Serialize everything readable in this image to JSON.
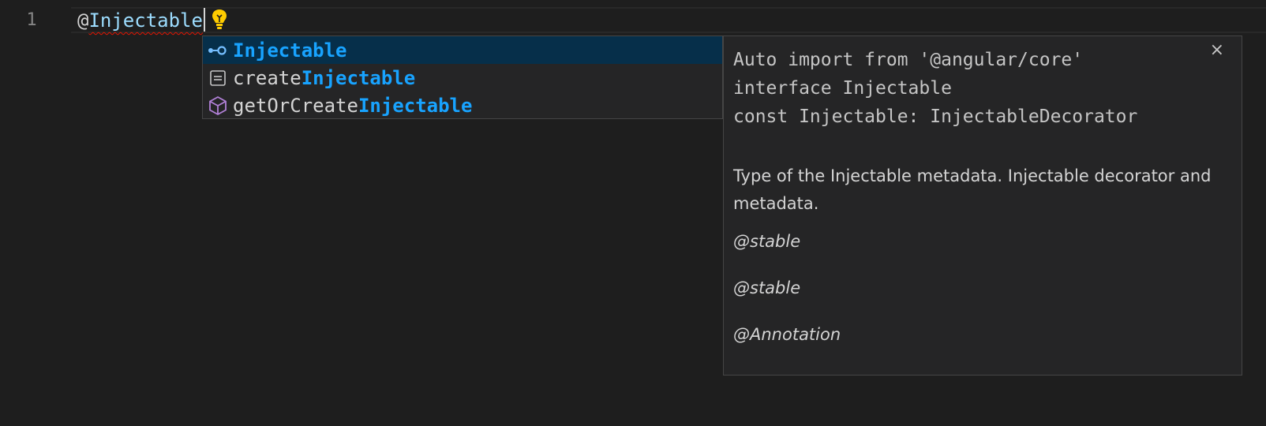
{
  "editor": {
    "line_number": "1",
    "code_prefix": "@",
    "code_identifier": "Injectable"
  },
  "suggest": {
    "items": [
      {
        "icon": "interface-icon",
        "prefix": "",
        "match": "Injectable",
        "selected": true
      },
      {
        "icon": "variable-icon",
        "prefix": "create",
        "match": "Injectable",
        "selected": false
      },
      {
        "icon": "module-icon",
        "prefix": "getOrCreate",
        "match": "Injectable",
        "selected": false
      }
    ]
  },
  "details": {
    "close_label": "×",
    "signature_lines": [
      "Auto import from '@angular/core'",
      "interface Injectable",
      "const Injectable: InjectableDecorator"
    ],
    "description": "Type of the Injectable metadata. Injectable decorator and metadata.",
    "tags": [
      "@stable",
      "@stable",
      "@Annotation"
    ]
  },
  "colors": {
    "background": "#1e1e1e",
    "selected_row": "#062f4a",
    "match_highlight": "#18a3ff",
    "error_squiggle": "#e51400",
    "lightbulb": "#ffcc00"
  }
}
